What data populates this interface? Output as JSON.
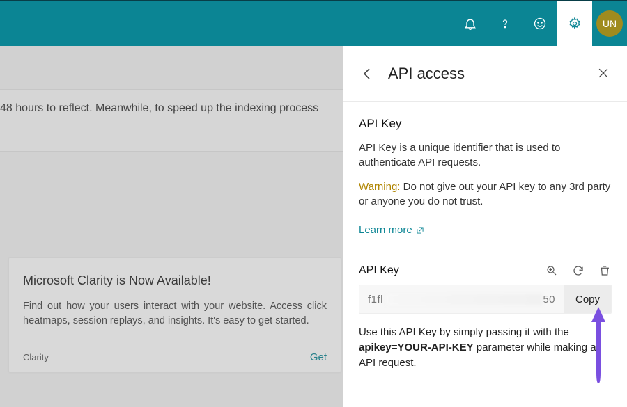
{
  "topbar": {
    "avatar_initials": "UN"
  },
  "background": {
    "info_strip_text": "48 hours to reflect. Meanwhile, to speed up the indexing process",
    "card": {
      "title": "Microsoft Clarity is Now Available!",
      "body": "Find out how your users interact with your website. Access click heatmaps, session replays, and insights. It's easy to get started.",
      "source": "Clarity",
      "action": "Get"
    }
  },
  "panel": {
    "title": "API access",
    "section_heading": "API Key",
    "description": "API Key is a unique identifier that is used to authenticate API requests.",
    "warning_label": "Warning:",
    "warning_text": " Do not give out your API key to any 3rd party or anyone you do not trust.",
    "learn_more": "Learn more",
    "key_label": "API Key",
    "key_value_prefix": "f1fl",
    "key_value_suffix": "50",
    "copy_label": "Copy",
    "usage_prefix": "Use this API Key by simply passing it with the ",
    "usage_param": "apikey=YOUR-API-KEY",
    "usage_suffix": " parameter while making an API request."
  }
}
